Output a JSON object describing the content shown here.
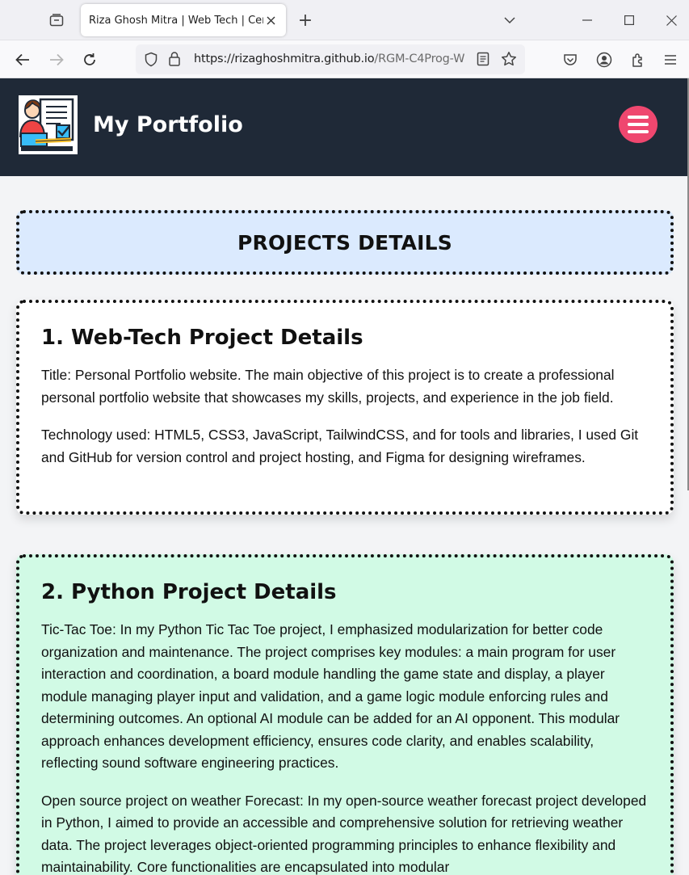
{
  "browser": {
    "tab_title": "Riza Ghosh Mitra | Web Tech | Cert",
    "tab_close_icon": "close-icon",
    "new_tab_label": "+",
    "url_host": "https://rizaghoshmitra.github.io",
    "url_path": "/RGM-C4Prog-W"
  },
  "header": {
    "site_title": "My Portfolio",
    "logo_icon": "developer-avatar-icon",
    "menu_icon": "hamburger-menu-icon",
    "accent_color": "#ef476f",
    "background_color": "#1f2937"
  },
  "main": {
    "section_heading": "PROJECTS DETAILS",
    "projects": [
      {
        "title": "1. Web-Tech Project Details",
        "background": "#ffffff",
        "paragraphs": [
          "Title: Personal Portfolio website. The main objective of this project is to create a professional personal portfolio website that showcases my skills, projects, and experience in the job field.",
          "Technology used: HTML5, CSS3, JavaScript, TailwindCSS, and for tools and libraries, I used Git and GitHub for version control and project hosting, and Figma for designing wireframes."
        ]
      },
      {
        "title": "2. Python Project Details",
        "background": "#d1fae5",
        "paragraphs": [
          "Tic-Tac Toe: In my Python Tic Tac Toe project, I emphasized modularization for better code organization and maintenance. The project comprises key modules: a main program for user interaction and coordination, a board module handling the game state and display, a player module managing player input and validation, and a game logic module enforcing rules and determining outcomes. An optional AI module can be added for an AI opponent. This modular approach enhances development efficiency, ensures code clarity, and enables scalability, reflecting sound software engineering practices.",
          "Open source project on weather Forecast: In my open-source weather forecast project developed in Python, I aimed to provide an accessible and comprehensive solution for retrieving weather data. The project leverages object-oriented programming principles to enhance flexibility and maintainability. Core functionalities are encapsulated into modular"
        ]
      }
    ]
  }
}
